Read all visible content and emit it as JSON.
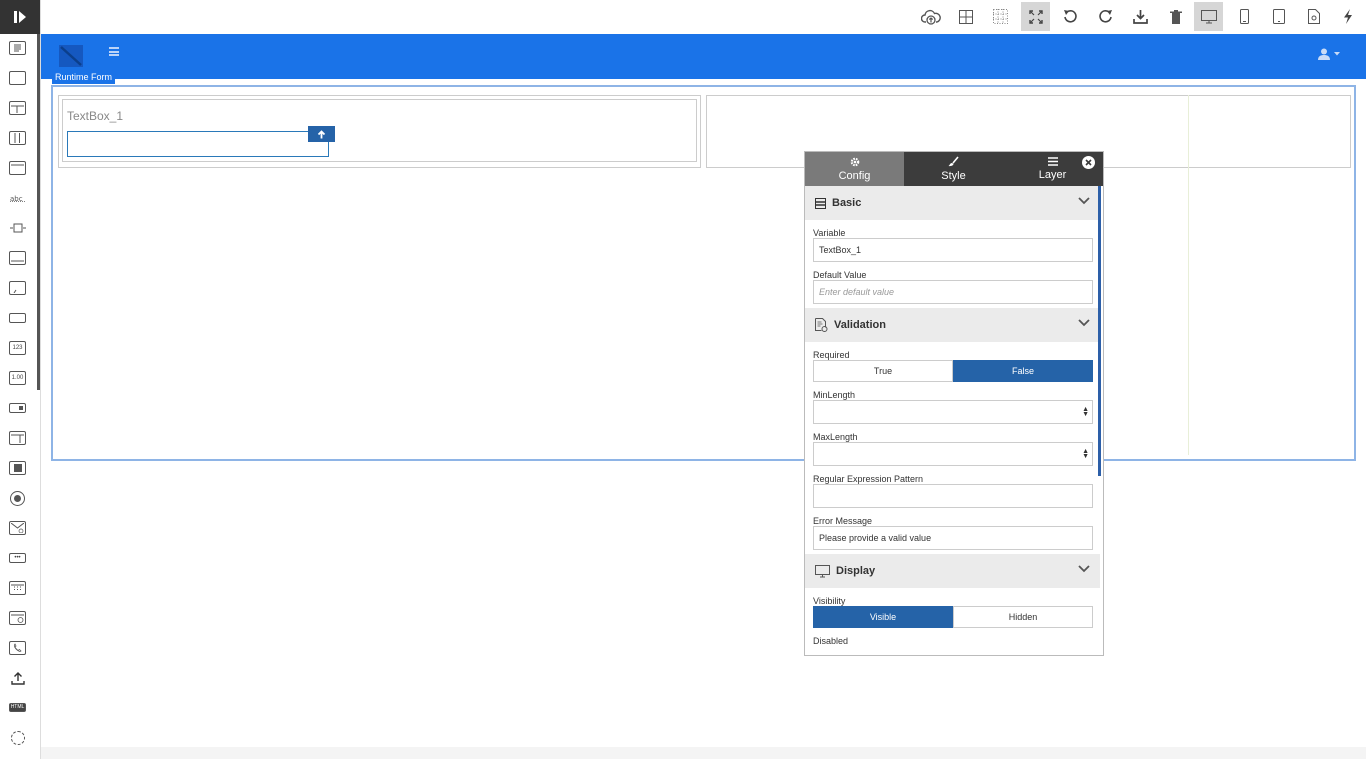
{
  "toolbar_left": {
    "tools": [
      "text-tool",
      "box-tool",
      "two-column-tool",
      "three-column-tool",
      "panel-tool",
      "label-tool",
      "slider-tool",
      "card-tool",
      "comment-tool",
      "textbox-tool",
      "number-tool",
      "decimal-tool",
      "dropdown-tool",
      "tab-panel-tool",
      "checkbox-tool",
      "radio-tool",
      "email-tool",
      "password-tool",
      "date-tool",
      "datetime-tool",
      "phone-tool",
      "upload-tool",
      "html-tool",
      "spinner-tool"
    ]
  },
  "toolbar_top": {
    "buttons": [
      "cloud-upload-icon",
      "grid-icon",
      "dotted-grid-icon",
      "fullscreen-icon",
      "undo-icon",
      "redo-icon",
      "download-icon",
      "trash-icon",
      "desktop-icon",
      "phone-icon",
      "tablet-icon",
      "settings-file-icon",
      "lightning-icon"
    ],
    "active": [
      "fullscreen-icon",
      "desktop-icon"
    ]
  },
  "form": {
    "runtime_label": "Runtime Form",
    "textbox_label": "TextBox_1"
  },
  "panel": {
    "tabs": [
      {
        "label": "Config",
        "icon": "gear-icon"
      },
      {
        "label": "Style",
        "icon": "brush-icon"
      },
      {
        "label": "Layer",
        "icon": "list-icon"
      }
    ],
    "basic": {
      "title": "Basic",
      "variable_label": "Variable",
      "variable_value": "TextBox_1",
      "default_label": "Default Value",
      "default_placeholder": "Enter default value"
    },
    "validation": {
      "title": "Validation",
      "required_label": "Required",
      "required_true": "True",
      "required_false": "False",
      "minlength_label": "MinLength",
      "maxlength_label": "MaxLength",
      "regex_label": "Regular Expression Pattern",
      "error_label": "Error Message",
      "error_value": "Please provide a valid value"
    },
    "display": {
      "title": "Display",
      "visibility_label": "Visibility",
      "visible": "Visible",
      "hidden": "Hidden",
      "disabled_label": "Disabled"
    }
  },
  "colors": {
    "accent": "#1a73e8",
    "selected": "#2563a8",
    "dark": "#3c3c3c"
  }
}
